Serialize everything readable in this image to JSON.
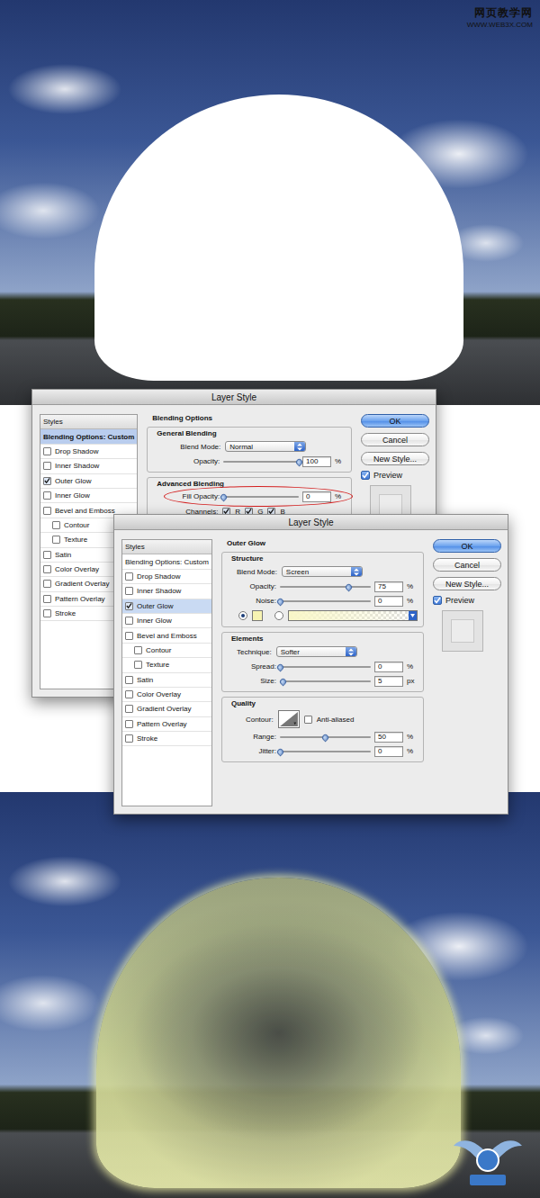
{
  "watermark": {
    "site": "网页教学网",
    "url": "WWW.WEB3X.COM"
  },
  "dialogs": [
    {
      "title": "Layer Style",
      "styles": [
        {
          "label": "Styles",
          "kind": "header",
          "checked": false,
          "selected": false
        },
        {
          "label": "Blending Options: Custom",
          "kind": "heading",
          "checked": false,
          "selected": true
        },
        {
          "label": "Drop Shadow",
          "kind": "effect",
          "checked": false,
          "selected": false
        },
        {
          "label": "Inner Shadow",
          "kind": "effect",
          "checked": false,
          "selected": false
        },
        {
          "label": "Outer Glow",
          "kind": "effect",
          "checked": true,
          "selected": false
        },
        {
          "label": "Inner Glow",
          "kind": "effect",
          "checked": false,
          "selected": false
        },
        {
          "label": "Bevel and Emboss",
          "kind": "effect",
          "checked": false,
          "selected": false
        },
        {
          "label": "Contour",
          "kind": "sub-effect",
          "checked": false,
          "selected": false
        },
        {
          "label": "Texture",
          "kind": "sub-effect",
          "checked": false,
          "selected": false
        },
        {
          "label": "Satin",
          "kind": "effect",
          "checked": false,
          "selected": false
        },
        {
          "label": "Color Overlay",
          "kind": "effect",
          "checked": false,
          "selected": false
        },
        {
          "label": "Gradient Overlay",
          "kind": "effect",
          "checked": false,
          "selected": false
        },
        {
          "label": "Pattern Overlay",
          "kind": "effect",
          "checked": false,
          "selected": false
        },
        {
          "label": "Stroke",
          "kind": "effect",
          "checked": false,
          "selected": false
        }
      ],
      "panel": {
        "title": "Blending Options",
        "groups": [
          {
            "title": "General Blending",
            "rows": [
              {
                "kind": "select",
                "label": "Blend Mode:",
                "value": "Normal"
              },
              {
                "kind": "slider",
                "label": "Opacity:",
                "value": "100",
                "unit": "%",
                "level": 1,
                "highlighted": false
              }
            ]
          },
          {
            "title": "Advanced Blending",
            "rows": [
              {
                "kind": "slider",
                "label": "Fill Opacity:",
                "value": "0",
                "unit": "%",
                "level": 0,
                "highlighted": true
              },
              {
                "kind": "channels",
                "label": "Channels:",
                "channels": [
                  {
                    "label": "R",
                    "checked": true
                  },
                  {
                    "label": "G",
                    "checked": true
                  },
                  {
                    "label": "B",
                    "checked": true
                  }
                ]
              }
            ]
          }
        ]
      },
      "buttons": [
        {
          "label": "OK",
          "default": true
        },
        {
          "label": "Cancel",
          "default": false
        },
        {
          "label": "New Style...",
          "default": false
        }
      ],
      "preview": {
        "label": "Preview",
        "checked": true
      }
    },
    {
      "title": "Layer Style",
      "styles": [
        {
          "label": "Styles",
          "kind": "header",
          "checked": false,
          "selected": false
        },
        {
          "label": "Blending Options: Custom",
          "kind": "plain",
          "checked": false,
          "selected": false
        },
        {
          "label": "Drop Shadow",
          "kind": "effect",
          "checked": false,
          "selected": false
        },
        {
          "label": "Inner Shadow",
          "kind": "effect",
          "checked": false,
          "selected": false
        },
        {
          "label": "Outer Glow",
          "kind": "effect",
          "checked": true,
          "selected": true
        },
        {
          "label": "Inner Glow",
          "kind": "effect",
          "checked": false,
          "selected": false
        },
        {
          "label": "Bevel and Emboss",
          "kind": "effect",
          "checked": false,
          "selected": false
        },
        {
          "label": "Contour",
          "kind": "sub-effect",
          "checked": false,
          "selected": false
        },
        {
          "label": "Texture",
          "kind": "sub-effect",
          "checked": false,
          "selected": false
        },
        {
          "label": "Satin",
          "kind": "effect",
          "checked": false,
          "selected": false
        },
        {
          "label": "Color Overlay",
          "kind": "effect",
          "checked": false,
          "selected": false
        },
        {
          "label": "Gradient Overlay",
          "kind": "effect",
          "checked": false,
          "selected": false
        },
        {
          "label": "Pattern Overlay",
          "kind": "effect",
          "checked": false,
          "selected": false
        },
        {
          "label": "Stroke",
          "kind": "effect",
          "checked": false,
          "selected": false
        }
      ],
      "panel": {
        "title": "Outer Glow",
        "groups": [
          {
            "title": "Structure",
            "rows": [
              {
                "kind": "select",
                "label": "Blend Mode:",
                "value": "Screen"
              },
              {
                "kind": "slider",
                "label": "Opacity:",
                "value": "75",
                "unit": "%",
                "level": 0.75,
                "highlighted": false
              },
              {
                "kind": "slider",
                "label": "Noise:",
                "value": "0",
                "unit": "%",
                "level": 0,
                "highlighted": false
              },
              {
                "kind": "source",
                "options": [
                  {
                    "kind": "color",
                    "selected": true,
                    "color": "#f7f3b2"
                  },
                  {
                    "kind": "gradient",
                    "selected": false,
                    "color": "#f9f7c8"
                  }
                ]
              }
            ]
          },
          {
            "title": "Elements",
            "rows": [
              {
                "kind": "select",
                "label": "Technique:",
                "value": "Softer"
              },
              {
                "kind": "slider",
                "label": "Spread:",
                "value": "0",
                "unit": "%",
                "level": 0,
                "highlighted": false
              },
              {
                "kind": "slider",
                "label": "Size:",
                "value": "5",
                "unit": "px",
                "level": 0.03,
                "highlighted": false
              }
            ]
          },
          {
            "title": "Quality",
            "rows": [
              {
                "kind": "contour",
                "label": "Contour:",
                "checkbox": {
                  "label": "Anti-aliased",
                  "checked": false
                }
              },
              {
                "kind": "slider",
                "label": "Range:",
                "value": "50",
                "unit": "%",
                "level": 0.5,
                "highlighted": false
              },
              {
                "kind": "slider",
                "label": "Jitter:",
                "value": "0",
                "unit": "%",
                "level": 0,
                "highlighted": false
              }
            ]
          }
        ]
      },
      "buttons": [
        {
          "label": "OK",
          "default": true
        },
        {
          "label": "Cancel",
          "default": false
        },
        {
          "label": "New Style...",
          "default": false
        }
      ],
      "preview": {
        "label": "Preview",
        "checked": true
      }
    }
  ]
}
